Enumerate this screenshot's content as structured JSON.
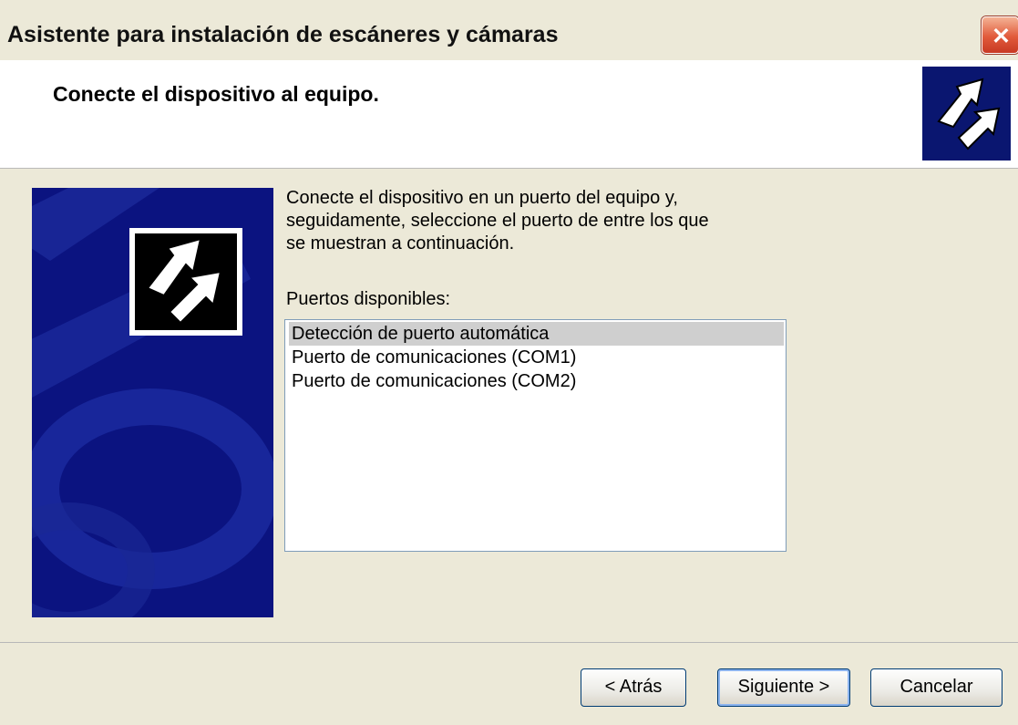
{
  "window": {
    "title": "Asistente para instalación de escáneres y cámaras"
  },
  "header": {
    "title": "Conecte el dispositivo al equipo."
  },
  "main": {
    "description_lines": [
      "Conecte el dispositivo en un puerto del equipo y,",
      "seguidamente, seleccione el puerto de entre los que",
      "se muestran a continuación."
    ],
    "ports_label": "Puertos disponibles:",
    "ports": [
      "Detección de puerto automática",
      "Puerto de comunicaciones (COM1)",
      "Puerto de comunicaciones (COM2)"
    ],
    "selected_port": "Detección de puerto automática"
  },
  "buttons": {
    "back": "< Atrás",
    "next": "Siguiente >",
    "cancel": "Cancelar"
  },
  "icons": {
    "close": "close-icon",
    "header": "scanner-camera-icon",
    "banner": "scanner-camera-icon"
  },
  "colors": {
    "banner_bg": "#0b1380",
    "close_bg": "#e15a3b",
    "selection": "#cfcfcf"
  }
}
